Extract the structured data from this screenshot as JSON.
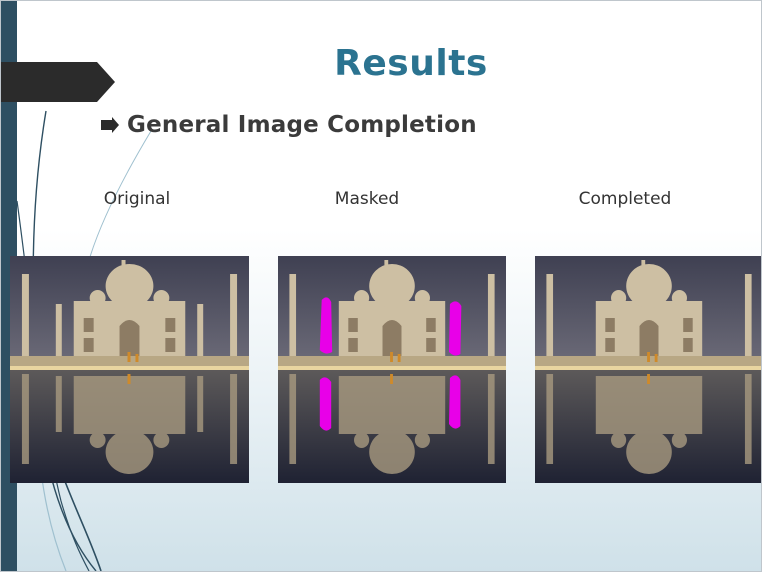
{
  "slide": {
    "title": "Results",
    "bullet": "General Image Completion",
    "captions": {
      "original": "Original",
      "masked": "Masked",
      "completed": "Completed"
    }
  },
  "colors": {
    "title": "#2b7390",
    "sidebar": "#2e4f62",
    "mask": "#e800e8"
  },
  "icons": {
    "bullet": "arrow-right-bullet-icon"
  }
}
